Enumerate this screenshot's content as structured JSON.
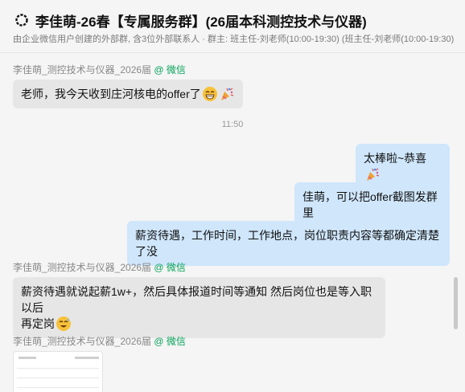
{
  "header": {
    "title": "李佳萌-26春【专属服务群】(26届本科测控技术与仪器)",
    "subtitle": "由企业微信用户创建的外部群, 含3位外部联系人 · 群主: 班主任-刘老师(10:00-19:30)  (班主任-刘老师(10:00-19:30)"
  },
  "messages": {
    "sender_name": "李佳萌_测控技术与仪器_2026届",
    "sender_tag": "@ 微信",
    "msg1": "老师，我今天收到庄河核电的offer了",
    "time1": "11:50",
    "msg2": "太棒啦~恭喜",
    "msg3": "佳萌，可以把offer截图发群里",
    "msg4": "薪资待遇，工作时间，工作地点，岗位职责内容等都确定清楚了没",
    "msg5_line1": "薪资待遇就说起薪1w+，然后具体报道时间等通知 然后岗位也是等入职以后",
    "msg5_line2": "再定岗"
  },
  "colors": {
    "incoming_bubble": "#e6e6e6",
    "outgoing_bubble": "#cfe6fb",
    "wechat_green": "#07a35a"
  },
  "icons": {
    "group": "group-ring-icon",
    "grin": "grinning-emoji-icon",
    "party": "party-popper-emoji-icon",
    "sweat": "sweat-smile-emoji-icon"
  }
}
